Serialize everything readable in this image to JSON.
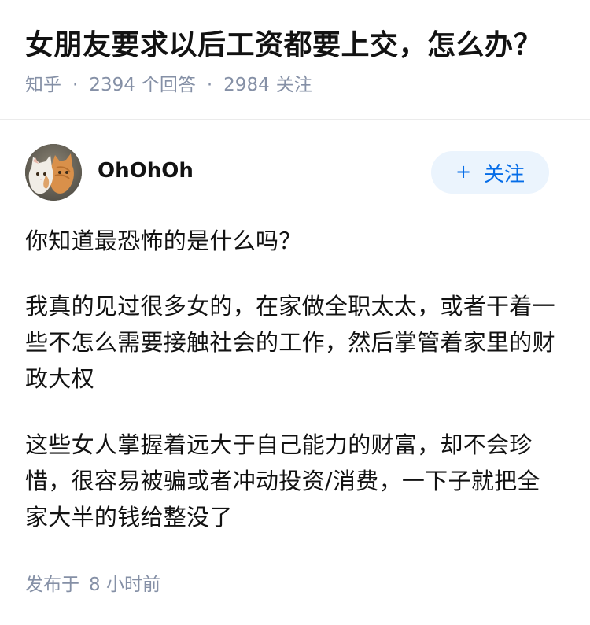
{
  "question": {
    "title": "女朋友要求以后工资都要上交，怎么办？",
    "source": "知乎",
    "separator": "·",
    "answer_count": "2394",
    "answer_label": "个回答",
    "follower_count": "2984",
    "follower_label": "关注"
  },
  "author": {
    "name": "OhOhOh",
    "avatar_icon": "cat-avatar-icon",
    "follow_plus": "+",
    "follow_label": "关注"
  },
  "answer": {
    "paragraphs": [
      "你知道最恐怖的是什么吗？",
      "我真的见过很多女的，在家做全职太太，或者干着一些不怎么需要接触社会的工作，然后掌管着家里的财政大权",
      "这些女人掌握着远大于自己能力的财富，却不会珍惜，很容易被骗或者冲动投资/消费，一下子就把全家大半的钱给整没了"
    ]
  },
  "footer": {
    "published_prefix": "发布于",
    "published_time": "8 小时前"
  },
  "colors": {
    "text": "#121212",
    "meta": "#8590a6",
    "accent": "#056de8",
    "follow_bg": "#ebf4fd",
    "divider": "#ebebeb"
  }
}
